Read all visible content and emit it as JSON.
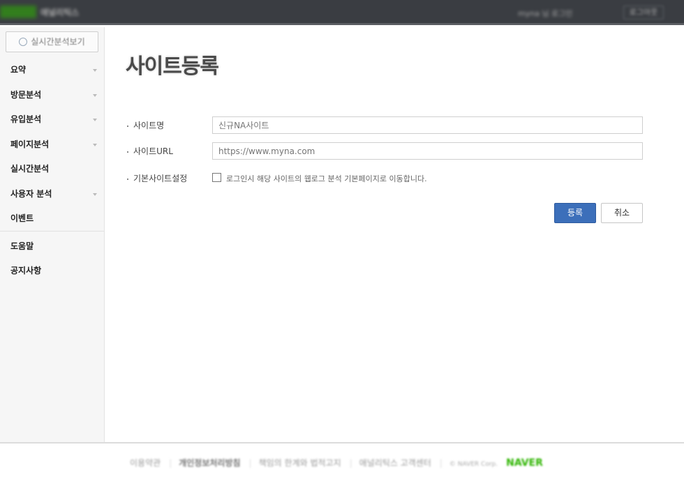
{
  "topbar": {
    "logo": "NAVER",
    "service": "애널리틱스",
    "user": "myna 님 로그인",
    "logout": "로그아웃"
  },
  "sidebar": {
    "realtime_button": "실시간분석보기",
    "menu": [
      {
        "label": "요약",
        "has_arrow": true
      },
      {
        "label": "방문분석",
        "has_arrow": true
      },
      {
        "label": "유입분석",
        "has_arrow": true
      },
      {
        "label": "페이지분석",
        "has_arrow": true
      },
      {
        "label": "실시간분석",
        "has_arrow": false
      },
      {
        "label": "사용자 분석",
        "has_arrow": true
      },
      {
        "label": "이벤트",
        "has_arrow": false
      }
    ],
    "menu2": [
      {
        "label": "도움말"
      },
      {
        "label": "공지사항"
      }
    ]
  },
  "main": {
    "title": "사이트등록",
    "fields": {
      "site_name_label": "사이트명",
      "site_name_placeholder": "신규NA사이트",
      "site_url_label": "사이트URL",
      "site_url_placeholder": "https://www.myna.com",
      "default_label": "기본사이트설정",
      "default_text": "로그인시 해당 사이트의 웹로그 분석 기본페이지로 이동합니다."
    },
    "buttons": {
      "submit": "등록",
      "cancel": "취소"
    }
  },
  "footer": {
    "terms": "이용약관",
    "privacy": "개인정보처리방침",
    "disclaimer": "책임의 한계와 법적고지",
    "support": "애널리틱스 고객센터",
    "copyright": "© NAVER Corp.",
    "brand": "NAVER"
  },
  "colors": {
    "primary_button": "#3c6fba",
    "topbar": "#3a3d42",
    "brand_green": "#2db400"
  }
}
